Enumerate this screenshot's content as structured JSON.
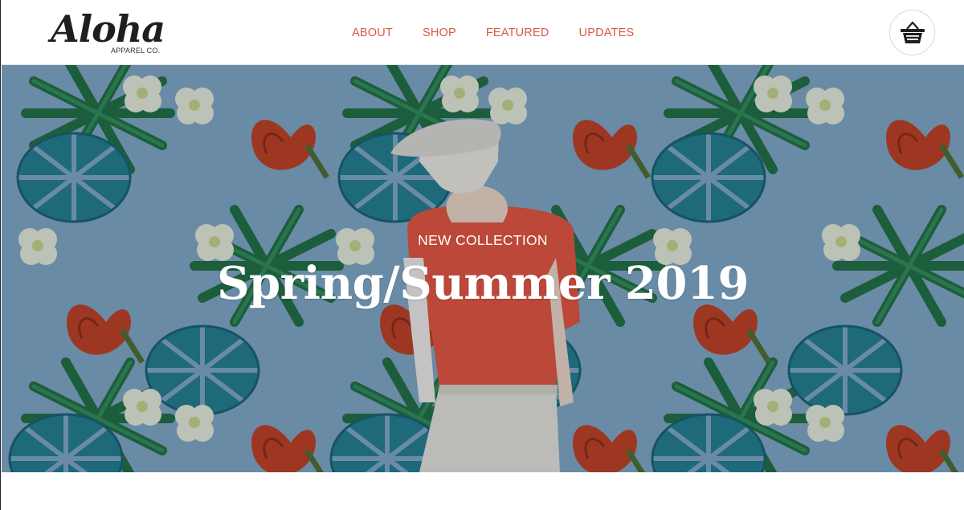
{
  "brand": {
    "logo_script": "Aloha",
    "logo_sub": "APPAREL CO."
  },
  "nav": {
    "items": [
      {
        "label": "ABOUT"
      },
      {
        "label": "SHOP"
      },
      {
        "label": "FEATURED"
      },
      {
        "label": "UPDATES"
      }
    ]
  },
  "cart": {
    "icon": "basket-icon"
  },
  "hero": {
    "kicker": "NEW COLLECTION",
    "title": "Spring/Summer 2019"
  },
  "colors": {
    "accent": "#d9584a",
    "hero_bg": "#7ea6c4",
    "text_dark": "#1f1f1f"
  }
}
